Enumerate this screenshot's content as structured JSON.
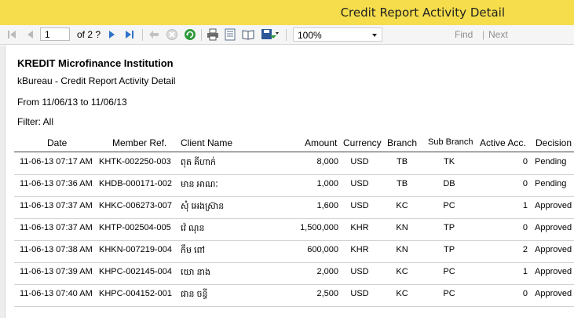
{
  "window": {
    "title": "Credit Report Activity Detail"
  },
  "toolbar": {
    "page_value": "1",
    "of_label": "of 2 ?",
    "zoom_value": "100%",
    "find_label": "Find",
    "next_label": "Next"
  },
  "report": {
    "institution": "KREDIT Microfinance Institution",
    "subtitle": "kBureau - Credit Report Activity Detail",
    "date_range": "From 11/06/13 to 11/06/13",
    "filter": "Filter: All",
    "headers": {
      "date": "Date",
      "member_ref": "Member Ref.",
      "client_name": "Client Name",
      "amount": "Amount",
      "currency": "Currency",
      "branch": "Branch",
      "sub_branch": "Sub Branch",
      "active_acc": "Active Acc.",
      "decision": "Decision"
    },
    "rows": [
      {
        "date": "11-06-13 07:17 AM",
        "member_ref": "KHTK-002250-003",
        "client_name": "ពុត គីហាក់",
        "amount": "8,000",
        "currency": "USD",
        "branch": "TB",
        "sub_branch": "TK",
        "active_acc": "0",
        "decision": "Pending"
      },
      {
        "date": "11-06-13 07:36 AM",
        "member_ref": "KHDB-000171-002",
        "client_name": "មាន អាណៈ",
        "amount": "1,000",
        "currency": "USD",
        "branch": "TB",
        "sub_branch": "DB",
        "active_acc": "0",
        "decision": "Pending"
      },
      {
        "date": "11-06-13 07:37 AM",
        "member_ref": "KHKC-006273-007",
        "client_name": "សុំ អេងស្រ៊ាន",
        "amount": "1,600",
        "currency": "USD",
        "branch": "KC",
        "sub_branch": "PC",
        "active_acc": "1",
        "decision": "Approved"
      },
      {
        "date": "11-06-13 07:37 AM",
        "member_ref": "KHTP-002504-005",
        "client_name": "វ៉េ ណុន",
        "amount": "1,500,000",
        "currency": "KHR",
        "branch": "KN",
        "sub_branch": "TP",
        "active_acc": "0",
        "decision": "Approved"
      },
      {
        "date": "11-06-13 07:38 AM",
        "member_ref": "KHKN-007219-004",
        "client_name": "កឹម ពៅ",
        "amount": "600,000",
        "currency": "KHR",
        "branch": "KN",
        "sub_branch": "TP",
        "active_acc": "2",
        "decision": "Approved"
      },
      {
        "date": "11-06-13 07:39 AM",
        "member_ref": "KHPC-002145-004",
        "client_name": "យោ នាង",
        "amount": "2,000",
        "currency": "USD",
        "branch": "KC",
        "sub_branch": "PC",
        "active_acc": "1",
        "decision": "Approved"
      },
      {
        "date": "11-06-13 07:40 AM",
        "member_ref": "KHPC-004152-001",
        "client_name": "ផាន ចន្ធី",
        "amount": "2,500",
        "currency": "USD",
        "branch": "KC",
        "sub_branch": "PC",
        "active_acc": "0",
        "decision": "Approved"
      }
    ]
  }
}
